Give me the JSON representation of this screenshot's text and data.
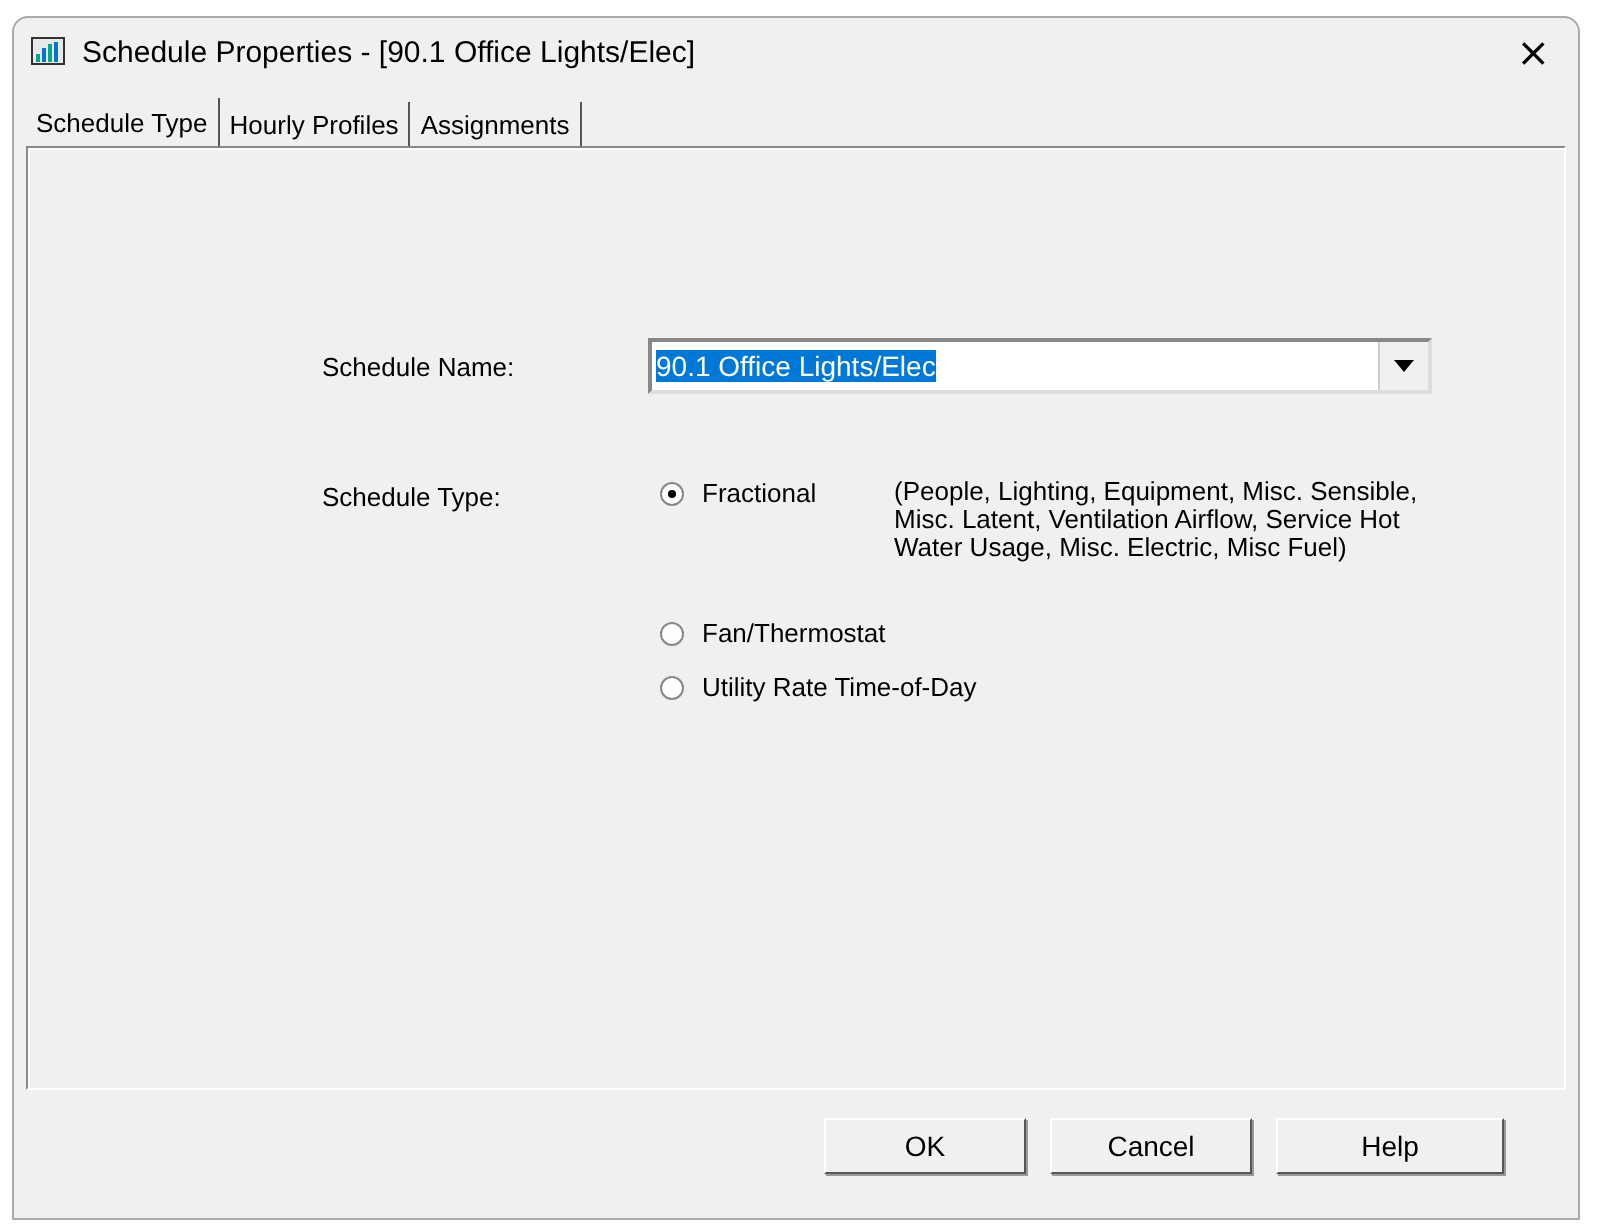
{
  "window": {
    "title": "Schedule Properties - [90.1 Office Lights/Elec]",
    "close": "×"
  },
  "tabs": [
    {
      "label": "Schedule Type",
      "selected": true
    },
    {
      "label": "Hourly Profiles",
      "selected": false
    },
    {
      "label": "Assignments",
      "selected": false
    }
  ],
  "schedule_name": {
    "label": "Schedule Name:",
    "value": "90.1 Office Lights/Elec"
  },
  "schedule_type": {
    "label": "Schedule Type:",
    "options": [
      {
        "label": "Fractional",
        "selected": true,
        "description": "(People, Lighting, Equipment, Misc. Sensible, Misc. Latent, Ventilation Airflow, Service Hot Water Usage, Misc. Electric, Misc Fuel)"
      },
      {
        "label": "Fan/Thermostat",
        "selected": false
      },
      {
        "label": "Utility Rate Time-of-Day",
        "selected": false
      }
    ]
  },
  "buttons": [
    "OK",
    "Cancel",
    "Help"
  ]
}
